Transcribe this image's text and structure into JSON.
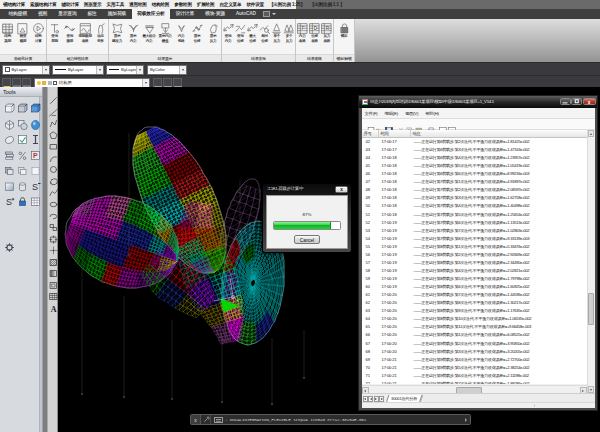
{
  "menu_bar": {
    "items": [
      "钢结构计算",
      "索膜结构计算",
      "辅助计算",
      "图形显示",
      "实用工具",
      "通用绘图",
      "结构绘图",
      "参数绘图",
      "扩展绘图",
      "自定义菜单",
      "软件设置",
      "【出图比例 1:25】",
      "【出图比例 1:1 】"
    ]
  },
  "ribbon": {
    "tabs": [
      {
        "label": "结构建模",
        "active": false
      },
      {
        "label": "视图",
        "active": false
      },
      {
        "label": "显示查询",
        "active": false
      },
      {
        "label": "标注",
        "active": false
      },
      {
        "label": "施加荷载",
        "active": false
      },
      {
        "label": "荷载效应分析",
        "active": true
      },
      {
        "label": "设计计算",
        "active": false
      },
      {
        "label": "模块·资源",
        "active": false
      },
      {
        "label": "AutoCAD",
        "active": false
      }
    ],
    "groups": [
      {
        "label": "自动化计算",
        "width": 47,
        "buttons": [
          {
            "line1": "结构",
            "line2": "类型",
            "icon": "grid"
          },
          {
            "line1": "检查",
            "line2": "模型",
            "icon": "docTri"
          },
          {
            "line1": "结构",
            "line2": "计算",
            "icon": "play"
          }
        ]
      },
      {
        "label": "动力特性结果",
        "width": 62,
        "buttons": [
          {
            "line1": "查询",
            "line2": "周期",
            "icon": "tglyph"
          },
          {
            "line1": "查询",
            "line2": "振型",
            "icon": "wave"
          },
          {
            "line1": "周期振型",
            "line2": "表格",
            "icon": "framewave"
          },
          {
            "line1": "动态",
            "line2": "变形",
            "icon": "person"
          }
        ]
      },
      {
        "label": "结果显示",
        "width": 113,
        "buttons": [
          {
            "line1": "显示",
            "line2": "膜应力",
            "icon": "star4"
          },
          {
            "line1": "显示",
            "line2": "内力",
            "icon": "vv"
          },
          {
            "line1": "最大组合",
            "line2": "内力",
            "icon": "trifun"
          },
          {
            "line1": "显示内力",
            "line2": "最值",
            "icon": "boxarrow"
          },
          {
            "line1": "内力",
            "line2": "包络",
            "icon": "vsmall"
          },
          {
            "line1": "显示",
            "line2": "位移",
            "icon": "zline"
          },
          {
            "line1": "显示",
            "line2": "反力",
            "icon": "hand"
          }
        ]
      },
      {
        "label": "结果查询",
        "width": 74,
        "buttons": [
          {
            "line1": "查询",
            "line2": "内力",
            "icon": "zq1"
          },
          {
            "line1": "查询",
            "line2": "位移",
            "icon": "zq2"
          },
          {
            "line1": "最大",
            "line2": "位移",
            "icon": "zq1"
          },
          {
            "line1": "相对",
            "line2": "位移",
            "icon": "zmag"
          },
          {
            "line1": "单个",
            "line2": "反力",
            "icon": "abase"
          },
          {
            "line1": "多个",
            "line2": "反力",
            "icon": "aa"
          }
        ]
      },
      {
        "label": "结果表格",
        "width": 38,
        "buttons": [
          {
            "line1": "内力",
            "line2": "表格",
            "icon": "ftab"
          },
          {
            "line1": "位移",
            "line2": "表格",
            "icon": "dtab"
          },
          {
            "line1": "反力",
            "line2": "表格",
            "icon": "rtab"
          }
        ]
      },
      {
        "label": "锁定/解锁",
        "width": 21,
        "buttons": [
          {
            "line1": "锁定",
            "line2": "",
            "icon": "lock"
          }
        ]
      }
    ]
  },
  "properties_toolbar": {
    "color_control": {
      "value": "ByLayer",
      "swatch": "color"
    },
    "linetype_control": {
      "value": "ByLayer",
      "swatch": "line"
    },
    "lineweight_control": {
      "value": "ByLayer",
      "swatch": "line"
    },
    "plotstyle_control": {
      "value": "ByColor",
      "swatch": "none"
    }
  },
  "layers_toolbar": {
    "layer_control": {
      "value": "结构层"
    }
  },
  "tools_palette": {
    "title": "Tools"
  },
  "dialog": {
    "title": "工况1-荷载步计算中",
    "progress_label": "87%",
    "progress_percent": 87,
    "cancel_label": "Cancel",
    "progress_color": "#22cc33"
  },
  "log_window": {
    "title": "日志 I:\\2019\\内部培训\\190601某项目\\模型\\中级\\190601某项目+1_V14.1",
    "menu": [
      "文件(F)",
      "编辑(E)",
      "视图(V)",
      "帮助(H)"
    ],
    "columns": [
      "序号",
      "时间",
      "信息"
    ],
    "rows": [
      {
        "seq": "42",
        "time": "17:00:17",
        "message": "——正在进行第6荷载步 第2次迭代 不平衡力收敛误差=+1.81425e-002"
      },
      {
        "seq": "43",
        "time": "17:00:17",
        "message": "——正在进行第6荷载步 第3次迭代 不平衡力收敛误差=+1.47163e-002"
      },
      {
        "seq": "44",
        "time": "17:00:18",
        "message": "——正在进行第6荷载步 第4次迭代 不平衡力收敛误差=+1.23957e-002"
      },
      {
        "seq": "45",
        "time": "17:00:18",
        "message": "——正在进行第6荷载步 第5次迭代 不平衡力收敛误差=+1.05419e-002"
      },
      {
        "seq": "46",
        "time": "17:00:18",
        "message": "——正在进行第6荷载步 第6次迭代 不平衡力收敛误差=+8.99234e-003"
      },
      {
        "seq": "47",
        "time": "17:00:18",
        "message": "——正在进行第7荷载步 第1次迭代 不平衡力收敛误差=+4.91897e-002"
      },
      {
        "seq": "48",
        "time": "17:00:18",
        "message": "——正在进行第7荷载步 第2次迭代 不平衡力收敛误差=+2.08597e-002"
      },
      {
        "seq": "49",
        "time": "17:00:18",
        "message": "——正在进行第7荷载步 第3次迭代 不平衡力收敛误差=+1.62758e-002"
      },
      {
        "seq": "50",
        "time": "17:00:18",
        "message": "——正在进行第7荷载步 第4次迭代 不平衡力收敛误差=+1.40498e-002"
      },
      {
        "seq": "51",
        "time": "17:00:18",
        "message": "——正在进行第7荷载步 第5次迭代 不平衡力收敛误差=+1.25654e-002"
      },
      {
        "seq": "52",
        "time": "17:00:19",
        "message": "——正在进行第7荷载步 第6次迭代 不平衡力收敛误差=+1.13513e-002"
      },
      {
        "seq": "53",
        "time": "17:00:19",
        "message": "——正在进行第7荷载步 第7次迭代 不平衡力收敛误差=+1.02863e-002"
      },
      {
        "seq": "54",
        "time": "17:00:19",
        "message": "——正在进行第7荷载步 第8次迭代 不平衡力收敛误差=+9.33139e-003"
      },
      {
        "seq": "55",
        "time": "17:00:19",
        "message": "——正在进行第8荷载步 第1次迭代 不平衡力收敛误差=+5.33476e-002"
      },
      {
        "seq": "56",
        "time": "17:00:19",
        "message": "——正在进行第8荷载步 第2次迭代 不平衡力收敛误差=+2.92669e-002"
      },
      {
        "seq": "57",
        "time": "17:00:19",
        "message": "——正在进行第8荷载步 第3次迭代 不平衡力收敛误差=+2.34490e-002"
      },
      {
        "seq": "58",
        "time": "17:00:19",
        "message": "——正在进行第8荷载步 第4次迭代 不平衡力收敛误差=+2.02821e-002"
      },
      {
        "seq": "59",
        "time": "17:00:19",
        "message": "——正在进行第8荷载步 第5次迭代 不平衡力收敛误差=+1.79798e-002"
      },
      {
        "seq": "60",
        "time": "17:00:19",
        "message": "——正在进行第8荷载步 第6次迭代 不平衡力收敛误差=+1.60925e-002"
      },
      {
        "seq": "61",
        "time": "17:00:20",
        "message": "——正在进行第8荷载步 第7次迭代 不平衡力收敛误差=+1.44596e-002"
      },
      {
        "seq": "62",
        "time": "17:00:20",
        "message": "——正在进行第8荷载步 第8次迭代 不平衡力收敛误差=+1.30217e-002"
      },
      {
        "seq": "63",
        "time": "17:00:20",
        "message": "——正在进行第8荷载步 第9次迭代 不平衡力收敛误差=+1.17635e-002"
      },
      {
        "seq": "64",
        "time": "17:00:20",
        "message": "——正在进行第8荷载步 第10次迭代 不平衡力收敛误差=+1.06535e-002"
      },
      {
        "seq": "65",
        "time": "17:00:20",
        "message": "——正在进行第8荷载步 第11次迭代 不平衡力收敛误差=+9.66458e-003"
      },
      {
        "seq": "66",
        "time": "17:00:20",
        "message": "——正在进行第9荷载步 第1次迭代 不平衡力收敛误差=+6.08525e-002"
      },
      {
        "seq": "67",
        "time": "17:00:20",
        "message": "——正在进行第9荷载步 第2次迭代 不平衡力收敛误差=+3.95850e-002"
      },
      {
        "seq": "68",
        "time": "17:00:20",
        "message": "——正在进行第9荷载步 第3次迭代 不平衡力收敛误差=+3.20205e-002"
      },
      {
        "seq": "69",
        "time": "17:00:21",
        "message": "——正在进行第9荷载步 第4次迭代 不平衡力收敛误差=+2.72700e-002"
      },
      {
        "seq": "70",
        "time": "17:00:21",
        "message": "——正在进行第9荷载步 第5次迭代 不平衡力收敛误差=+2.38254e-002"
      },
      {
        "seq": "71",
        "time": "17:00:21",
        "message": "——正在进行第9荷载步 第6次迭代 不平衡力收敛误差=+2.11198e-002"
      },
      {
        "seq": "72",
        "time": "17:00:21",
        "message": "——正在进行第9荷载步 第7次迭代 不平衡力收敛误差=+1.88286e-002"
      }
    ],
    "tab": "30001迭代分析"
  },
  "command_line": {
    "text": "- ONCALINTEGRATION_FLEXIBLE   step=9   item=5   err=2.38254E-002"
  },
  "colors": {
    "canvas": "#000000",
    "chrome_dark": "#3e3e3e",
    "ribbon_light": "#f4f4f4",
    "accent_green": "#22cc33",
    "close_red": "#c0392b"
  }
}
